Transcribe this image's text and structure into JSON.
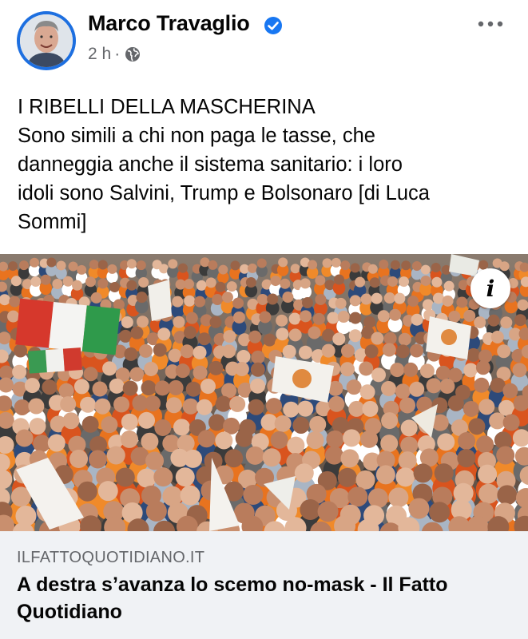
{
  "post": {
    "author": "Marco Travaglio",
    "time": "2 h",
    "separator": "·",
    "lines": [
      "I RIBELLI DELLA MASCHERINA",
      "Sono simili a chi non paga le tasse, che",
      "danneggia anche il sistema sanitario: i loro",
      "idoli sono Salvini, Trump e Bolsonaro [di Luca",
      "Sommi]"
    ]
  },
  "image": {
    "info_label": "i"
  },
  "link": {
    "domain": "ILFATTOQUOTIDIANO.IT",
    "title": "A destra s’avanza lo scemo no-mask - Il Fatto Quotidiano"
  },
  "icons": {
    "verified": "verified-badge-icon",
    "globe": "globe-icon",
    "more": "more-options-icon"
  },
  "colors": {
    "verified_blue": "#1877f2",
    "meta_grey": "#65676b",
    "preview_bg": "#f0f2f5"
  }
}
